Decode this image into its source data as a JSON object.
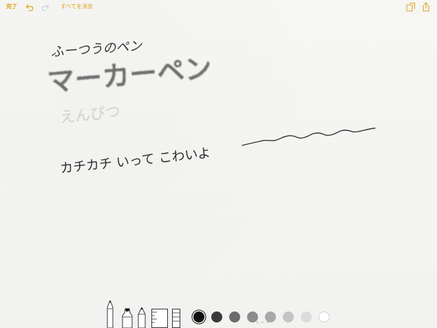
{
  "toolbar": {
    "done_label": "完了",
    "clear_all_label": "すべてを消去",
    "accent_color": "#e0a21a",
    "icons": [
      "undo-icon",
      "redo-icon",
      "new-note-icon",
      "share-icon"
    ]
  },
  "canvas": {
    "handwriting": {
      "line1": "ふーつうのペン",
      "line2": "マーカーペン",
      "line3": "えんぴつ",
      "line4": "カチカチ いって こわいよ"
    }
  },
  "palette": {
    "tools": [
      "pen-tool",
      "marker-tool",
      "pencil-tool",
      "ruler-tool",
      "eraser-tool"
    ],
    "colors": [
      "#111111",
      "#3a3a3a",
      "#6b6b6b",
      "#8c8c8c",
      "#a9a9a9",
      "#c4c4c4",
      "#dcdcdc",
      "#ffffff"
    ],
    "selected_color_index": 0,
    "page_indicator": "• • •"
  }
}
